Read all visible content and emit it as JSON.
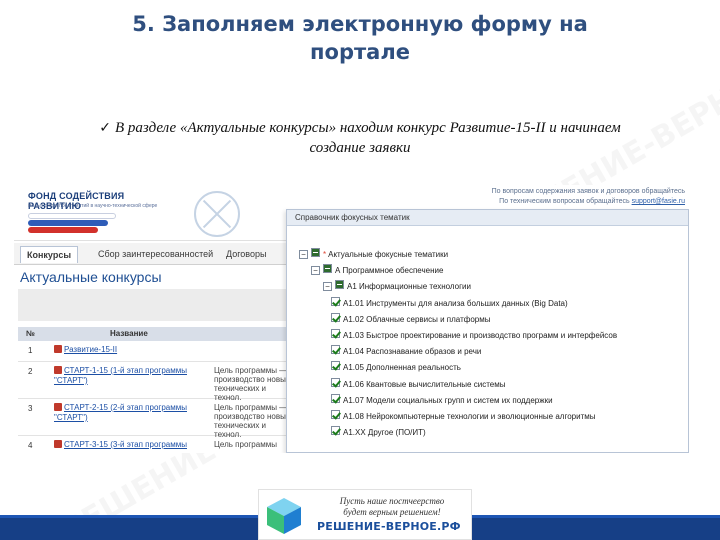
{
  "slide": {
    "title_line1": "5. Заполняем электронную форму на",
    "title_line2": "портале",
    "check": "✓",
    "subtitle_line1": "В разделе «Актуальные конкурсы» находим конкурс Развитие-15-II и начинаем",
    "subtitle_line2": "создание заявки",
    "watermark": "РЕШЕНИЕ-ВЕРНОЕ.РФ"
  },
  "portal": {
    "logo_main": "ФОНД СОДЕЙСТВИЯ РАЗВИТИЮ",
    "logo_sub": "малых форм предприятий в научно-технической сфере",
    "contact_line1": "По вопросам содержания заявок и договоров обращайтесь",
    "contact_line2_prefix": "По техническим вопросам обращайтесь",
    "contact_email": "support@fasie.ru",
    "tabs": [
      {
        "label": "Конкурсы"
      },
      {
        "label": "Сбор заинтересованностей"
      },
      {
        "label": "Договоры"
      }
    ],
    "section_title": "Актуальные конкурсы",
    "table_headers": {
      "num": "№",
      "name": "Название"
    },
    "rows": [
      {
        "num": "1",
        "name": "Развитие-15-II",
        "desc": ""
      },
      {
        "num": "2",
        "name": "СТАРТ-1-15 (1-й этап программы \"СТАРТ\")",
        "desc": "Цель программы — производство новых технических и технол."
      },
      {
        "num": "3",
        "name": "СТАРТ-2-15 (2-й этап программы \"СТАРТ\")",
        "desc": "Цель программы — производство новых технических и технол."
      },
      {
        "num": "4",
        "name": "СТАРТ-3-15 (3-й этап программы",
        "desc": "Цель программы"
      }
    ]
  },
  "popup": {
    "title": "Справочник фокусных тематик",
    "tree": [
      {
        "toggle": "−",
        "state": "part",
        "star": true,
        "label": "Актуальные фокусные тематики"
      },
      {
        "toggle": "−",
        "state": "part",
        "star": false,
        "label": "А Программное обеспечение"
      },
      {
        "toggle": "−",
        "state": "part",
        "star": false,
        "label": "А1 Информационные технологии"
      },
      {
        "toggle": "",
        "state": "chk",
        "star": false,
        "label": "А1.01 Инструменты для анализа больших данных (Big Data)"
      },
      {
        "toggle": "",
        "state": "chk",
        "star": false,
        "label": "А1.02 Облачные сервисы и платформы"
      },
      {
        "toggle": "",
        "state": "chk",
        "star": false,
        "label": "А1.03 Быстрое проектирование и производство программ и интерфейсов"
      },
      {
        "toggle": "",
        "state": "chk",
        "star": false,
        "label": "А1.04 Распознавание образов и речи"
      },
      {
        "toggle": "",
        "state": "chk",
        "star": false,
        "label": "А1.05 Дополненная реальность"
      },
      {
        "toggle": "",
        "state": "chk",
        "star": false,
        "label": "А1.06 Квантовые вычислительные системы"
      },
      {
        "toggle": "",
        "state": "chk",
        "star": false,
        "label": "А1.07 Модели социальных групп и систем их поддержки"
      },
      {
        "toggle": "",
        "state": "chk",
        "star": false,
        "label": "А1.08 Нейрокомпьютерные технологии и эволюционные алгоритмы"
      },
      {
        "toggle": "",
        "state": "chk",
        "star": false,
        "label": "А1.ХХ Другое (ПО/ИТ)"
      }
    ]
  },
  "brand": {
    "slogan_line1": "Пусть наше постчеерство",
    "slogan_line2": "будет верным решением!",
    "name": "РЕШЕНИЕ-ВЕРНОЕ.РФ"
  },
  "colors": {
    "title": "#2f4f7f",
    "bottom_bar": "#163f86",
    "link": "#1c4fa5"
  }
}
